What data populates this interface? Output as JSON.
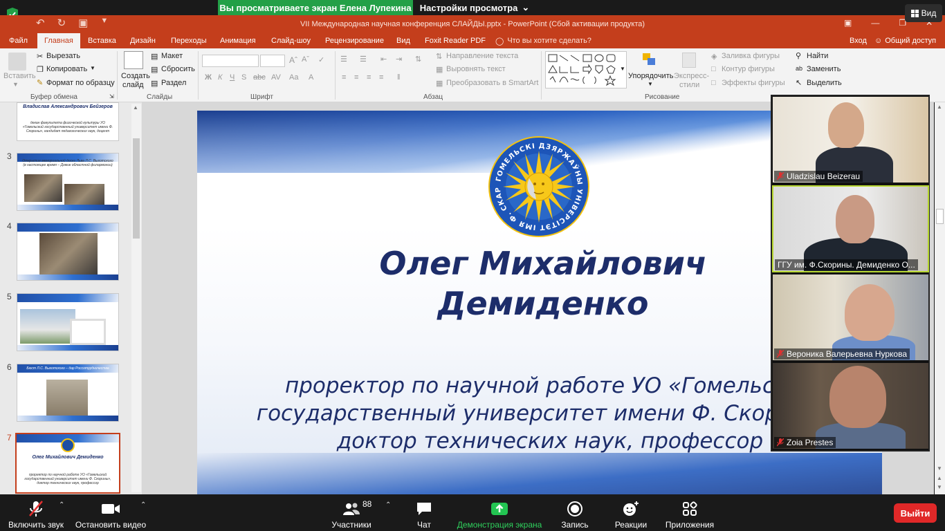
{
  "zoom": {
    "share_banner": "Вы просматриваете экран Елена Лупекина",
    "view_settings": "Настройки просмотра",
    "view_button": "Вид",
    "bottom": {
      "unmute": "Включить звук",
      "stop_video": "Остановить видео",
      "participants": "Участники",
      "participants_count": "88",
      "chat": "Чат",
      "share_screen": "Демонстрация экрана",
      "record": "Запись",
      "reactions": "Реакции",
      "apps": "Приложения",
      "leave": "Выйти"
    },
    "accent_green": "#23a047",
    "leave_red": "#e02828"
  },
  "powerpoint": {
    "title": "VII Международная научная конференция СЛАЙДЫ.pptx - PowerPoint (Сбой активации продукта)",
    "brand_color": "#c43e1c",
    "tabs": [
      "Файл",
      "Главная",
      "Вставка",
      "Дизайн",
      "Переходы",
      "Анимация",
      "Слайд-шоу",
      "Рецензирование",
      "Вид",
      "Foxit Reader PDF"
    ],
    "active_tab": "Главная",
    "tell_me": "Что вы хотите сделать?",
    "sign_in": "Вход",
    "share": "Общий доступ",
    "ribbon": {
      "clipboard": {
        "paste": "Вставить",
        "cut": "Вырезать",
        "copy": "Копировать",
        "format_painter": "Формат по образцу",
        "label": "Буфер обмена"
      },
      "slides": {
        "new_slide_1": "Создать",
        "new_slide_2": "слайд",
        "layout": "Макет",
        "reset": "Сбросить",
        "section": "Раздел",
        "label": "Слайды"
      },
      "font": {
        "label": "Шрифт"
      },
      "paragraph": {
        "text_direction": "Направление текста",
        "align_text": "Выровнять текст",
        "smartart": "Преобразовать в SmartArt",
        "label": "Абзац"
      },
      "drawing": {
        "arrange": "Упорядочить",
        "quick_styles_1": "Экспресс-",
        "quick_styles_2": "стили",
        "shape_fill": "Заливка фигуры",
        "shape_outline": "Контур фигуры",
        "shape_effects": "Эффекты фигуры",
        "label": "Рисование"
      },
      "editing": {
        "find": "Найти",
        "replace": "Заменить",
        "select": "Выделить"
      }
    },
    "thumbnails": [
      {
        "num": "",
        "caption_top": "Владислав Александрович Бейзеров",
        "caption_body": "декан факультета физической культуры УО «Гомельский государственный университет имени Ф. Скорины», кандидат педагогических наук, доцент"
      },
      {
        "num": "3",
        "caption_top": "Открытие мемориальной доски Льва Л.С. Выготского (в настоящее время – Домик областной филармонии)"
      },
      {
        "num": "4"
      },
      {
        "num": "5"
      },
      {
        "num": "6",
        "caption_top": "Бюст Л.С. Выготского – дар Россотрудничества"
      },
      {
        "num": "7",
        "caption_top": "Олег Михайлович Демиденко",
        "caption_body": "проректор по научной работе УО «Гомельский государственный университет имени Ф. Скорины», доктор технических наук, профессор"
      }
    ],
    "slide": {
      "name_line1": "Олег Михайлович",
      "name_line2": "Демиденко",
      "desc_line1": "проректор по научной работе УО «Гомельский",
      "desc_line2": "государственный университет имени Ф. Скорины»,",
      "desc_line3": "доктор технических наук, профессор",
      "logo_text": "ГОМЕЛЬСКІ ДЗЯРЖАЎНЫ УНІВЕРСІТЭТ ІМЯ Ф. СКАРЫНЫ"
    }
  },
  "participants_video": [
    {
      "name": "Uladzislau  Beizerau",
      "muted": true
    },
    {
      "name": "ГГУ им. Ф.Скорины.  Демиденко О...",
      "muted": false
    },
    {
      "name": "Вероника Валерьевна Нуркова",
      "muted": true
    },
    {
      "name": "Zoia Prestes",
      "muted": true
    }
  ]
}
